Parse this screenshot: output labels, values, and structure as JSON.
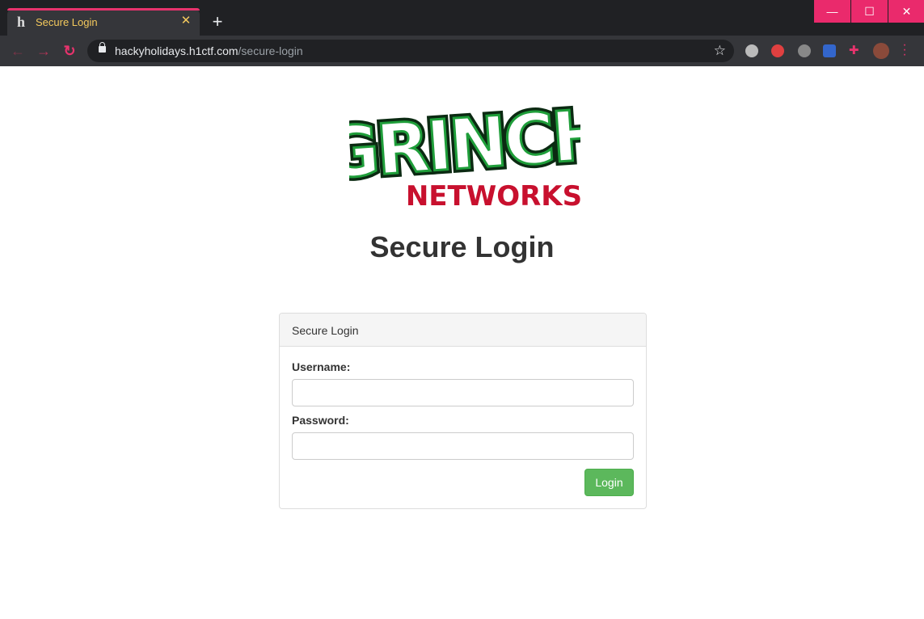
{
  "browser": {
    "tab_favicon": "h",
    "tab_title": "Secure Login",
    "tab_close": "✕",
    "new_tab": "+",
    "url_host": "hackyholidays.h1ctf.com",
    "url_path": "/secure-login",
    "window": {
      "minimize": "—",
      "maximize": "☐",
      "close": "✕"
    },
    "nav": {
      "back": "←",
      "forward": "→",
      "reload": "↻"
    }
  },
  "page": {
    "logo": {
      "top_word": "GRINCH",
      "bottom_word": "NETWORKS",
      "green": "#1f9e3a",
      "red": "#c8102e"
    },
    "title": "Secure Login",
    "panel": {
      "heading": "Secure Login",
      "username_label": "Username:",
      "password_label": "Password:",
      "username_value": "",
      "password_value": "",
      "login_button": "Login"
    }
  },
  "colors": {
    "accent": "#e8336d",
    "button": "#5cb85c"
  }
}
